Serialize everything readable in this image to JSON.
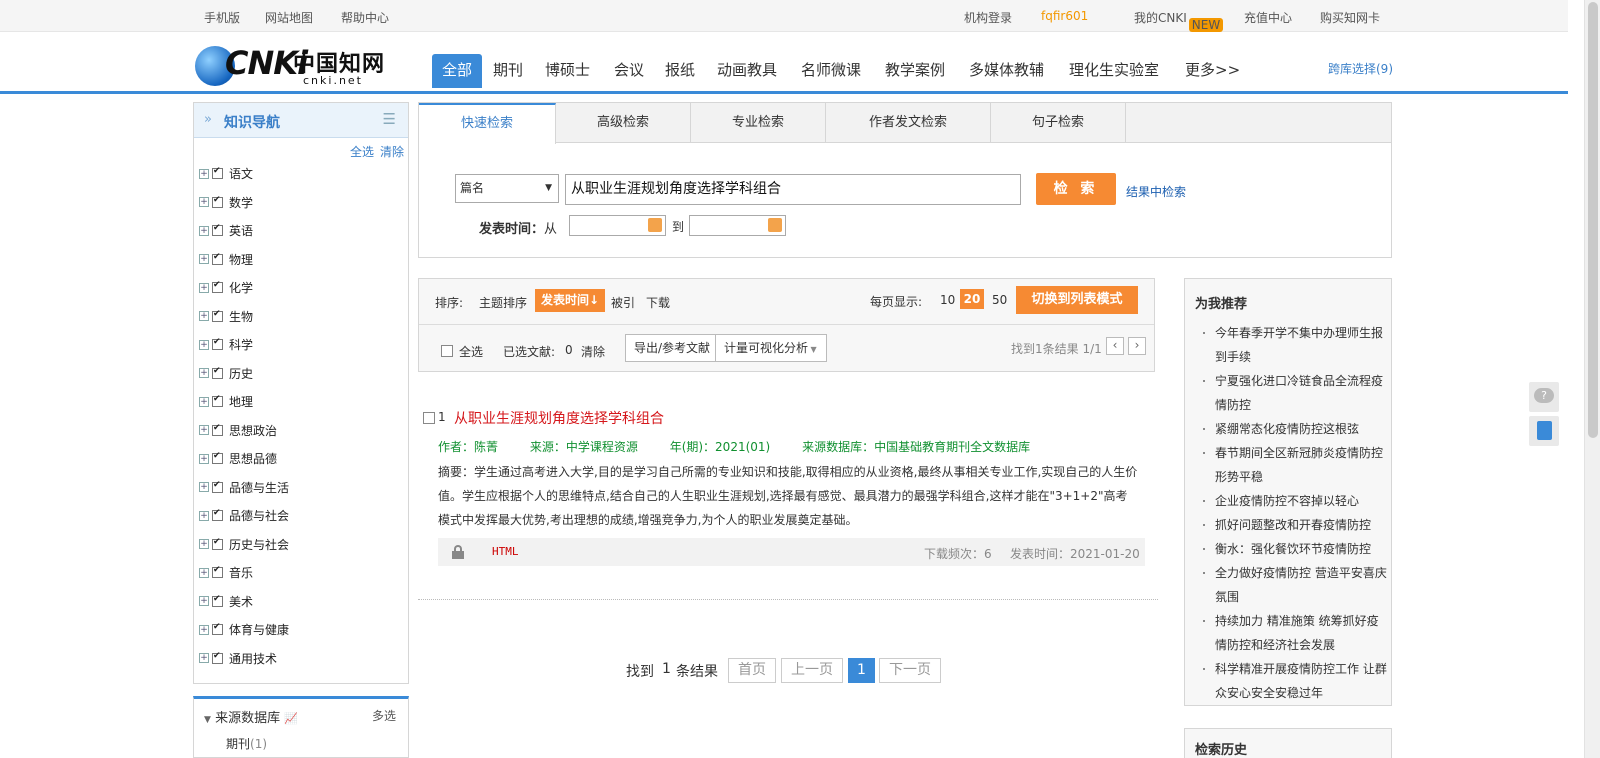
{
  "topbar": {
    "mobile": "手机版",
    "sitemap": "网站地图",
    "help": "帮助中心",
    "org_login": "机构登录",
    "username": "fqfir601",
    "my_cnki": "我的CNKI",
    "new_badge": "NEW",
    "recharge": "充值中心",
    "buy_card": "购买知网卡"
  },
  "logo": {
    "mark": "CNKi",
    "zh": "中国知网",
    "domain": "cnki.net"
  },
  "nav": {
    "items": [
      "全部",
      "期刊",
      "博硕士",
      "会议",
      "报纸",
      "动画教具",
      "名师微课",
      "教学案例",
      "多媒体教辅",
      "理化生实验室",
      "更多>>"
    ],
    "cross_db": "跨库选择(9)"
  },
  "sidebar": {
    "title": "知识导航",
    "select_all": "全选",
    "clear": "清除",
    "subjects": [
      "语文",
      "数学",
      "英语",
      "物理",
      "化学",
      "生物",
      "科学",
      "历史",
      "地理",
      "思想政治",
      "思想品德",
      "品德与生活",
      "品德与社会",
      "历史与社会",
      "音乐",
      "美术",
      "体育与健康",
      "通用技术"
    ]
  },
  "source_db": {
    "title": "来源数据库",
    "multi": "多选",
    "first_item": "期刊",
    "first_count": "(1)"
  },
  "search": {
    "tabs": [
      "快速检索",
      "高级检索",
      "专业检索",
      "作者发文检索",
      "句子检索"
    ],
    "field": "篇名",
    "query": "从职业生涯规划角度选择学科组合",
    "button": "检 索",
    "in_results": "结果中检索",
    "pub_time_label": "发表时间：",
    "from": "从",
    "to": "到"
  },
  "results_bar": {
    "sort_label": "排序:",
    "sort_topic": "主题排序",
    "sort_pubtime": "发表时间↓",
    "sort_cited": "被引",
    "sort_download": "下载",
    "per_page_label": "每页显示:",
    "per_page_10": "10",
    "per_page_20": "20",
    "per_page_50": "50",
    "list_mode": "切换到列表模式",
    "select_all": "全选",
    "selected_label": "已选文献:",
    "selected_count": "0",
    "clear": "清除",
    "export": "导出/参考文献",
    "visual": "计量可视化分析",
    "found": "找到1条结果 1/1"
  },
  "result": {
    "number": "1",
    "title": "从职业生涯规划角度选择学科组合",
    "author": "作者：陈菁",
    "source": "来源：中学课程资源",
    "year": "年(期)：2021(01)",
    "database": "来源数据库：中国基础教育期刊全文数据库",
    "abstract": "摘要：学生通过高考进入大学,目的是学习自己所需的专业知识和技能,取得相应的从业资格,最终从事相关专业工作,实现自己的人生价值。学生应根据个人的思维特点,结合自己的人生职业生涯规划,选择最有感觉、最具潜力的最强学科组合,这样才能在\"3+1+2\"高考模式中发挥最大优势,考出理想的成绩,增强竞争力,为个人的职业发展奠定基础。",
    "html_label": "HTML",
    "downloads": "下载频次：6",
    "pub_date": "发表时间：2021-01-20"
  },
  "pager": {
    "found_prefix": "找到",
    "found_count": "1",
    "found_suffix": "条结果",
    "first": "首页",
    "prev": "上一页",
    "current": "1",
    "next": "下一页"
  },
  "recommend": {
    "title": "为我推荐",
    "items": [
      "今年春季开学不集中办理师生报到手续",
      "宁夏强化进口冷链食品全流程疫情防控",
      "紧绷常态化疫情防控这根弦",
      "春节期间全区新冠肺炎疫情防控形势平稳",
      "企业疫情防控不容掉以轻心",
      "抓好问题整改和开春疫情防控",
      "衡水：强化餐饮环节疫情防控",
      "全力做好疫情防控 营造平安喜庆氛围",
      "持续加力 精准施策 统筹抓好疫情防控和经济社会发展",
      "科学精准开展疫情防控工作 让群众安心安全安稳过年"
    ]
  },
  "history": {
    "title": "检索历史"
  },
  "icons": [
    "logo-globe-icon",
    "double-arrow-icon",
    "menu-icon",
    "plus-icon",
    "check-icon",
    "dropdown-arrow-icon",
    "calendar-icon",
    "chart-icon",
    "lock-icon",
    "chevron-left-icon",
    "chevron-right-icon",
    "chat-icon",
    "document-icon"
  ],
  "colors": {
    "accent": "#3a8ad8",
    "orange": "#f68a33",
    "title_red": "#d5171b",
    "meta_green": "#119030"
  }
}
